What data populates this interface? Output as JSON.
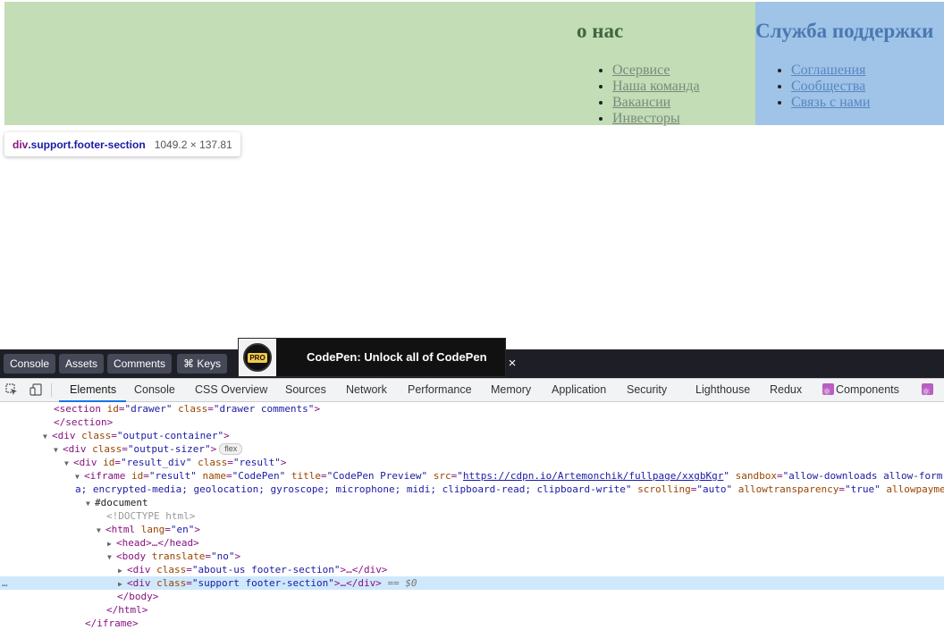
{
  "preview": {
    "about": {
      "heading": "о нас",
      "links": [
        "Осервисе",
        "Наша команда",
        "Вакансии",
        "Инвесторы"
      ]
    },
    "support": {
      "heading": "Служба поддержки",
      "links": [
        "Соглашения",
        "Сообщества",
        "Связь с нами"
      ]
    },
    "inspect_tooltip": {
      "tag": "div",
      "classes": ".support.footer-section",
      "dimensions": "1049.2 × 137.81"
    }
  },
  "codepen_bar": {
    "buttons": [
      "Console",
      "Assets",
      "Comments",
      "⌘ Keys"
    ],
    "promo_badge": "PRO",
    "promo_text": "CodePen: Unlock all of CodePen",
    "close": "×"
  },
  "devtools": {
    "tabs": [
      "Elements",
      "Console",
      "CSS Overview",
      "Sources",
      "Network",
      "Performance",
      "Memory",
      "Application",
      "Security",
      "Lighthouse",
      "Redux",
      "Components"
    ],
    "active_tab": "Elements",
    "dom": {
      "r1": {
        "tag": "<section",
        "a1": "id",
        "v1": "\"drawer\"",
        "a2": "class",
        "v2": "\"drawer comments\"",
        "end": ">"
      },
      "r2": {
        "text": "</section>"
      },
      "r3": {
        "tag": "<div",
        "a1": "class",
        "v1": "\"output-container\"",
        "end": ">"
      },
      "r4": {
        "tag": "<div",
        "a1": "class",
        "v1": "\"output-sizer\"",
        "end": ">",
        "badge": "flex"
      },
      "r5": {
        "tag": "<div",
        "a1": "id",
        "v1": "\"result_div\"",
        "a2": "class",
        "v2": "\"result\"",
        "end": ">"
      },
      "r6": {
        "tag": "<iframe",
        "a1": "id",
        "v1": "\"result\"",
        "a2": "name",
        "v2": "\"CodePen\"",
        "a3": "title",
        "v3": "\"CodePen Preview\"",
        "a4": "src",
        "v4": "https://cdpn.io/Artemonchik/fullpage/xxgbKgr",
        "a5": "sandbox",
        "v5": "\"allow-downloads allow-form"
      },
      "r7": {
        "text1": "a; encrypted-media; geolocation; gyroscope; microphone; midi; clipboard-read; clipboard-write\"",
        "a1": "scrolling",
        "v1": "\"auto\"",
        "a2": "allowtransparency",
        "v2": "\"true\"",
        "a3": "allowpayme"
      },
      "r8": {
        "text": "#document"
      },
      "r9": {
        "text": "<!DOCTYPE html>"
      },
      "r10": {
        "tag": "<html",
        "a1": "lang",
        "v1": "\"en\"",
        "end": ">"
      },
      "r11": {
        "text": "<head>…</head>"
      },
      "r12": {
        "tag": "<body",
        "a1": "translate",
        "v1": "\"no\"",
        "end": ">"
      },
      "r13": {
        "tag": "<div",
        "a1": "class",
        "v1": "\"about-us footer-section\"",
        "end": ">…</div>"
      },
      "r14": {
        "tag": "<div",
        "a1": "class",
        "v1": "\"support footer-section\"",
        "end": ">…</div>",
        "eq": "==",
        "dollar": "$0",
        "dots": "…"
      },
      "r15": {
        "text": "</body>"
      },
      "r16": {
        "text": "</html>"
      },
      "r17": {
        "text": "</iframe>"
      }
    }
  }
}
